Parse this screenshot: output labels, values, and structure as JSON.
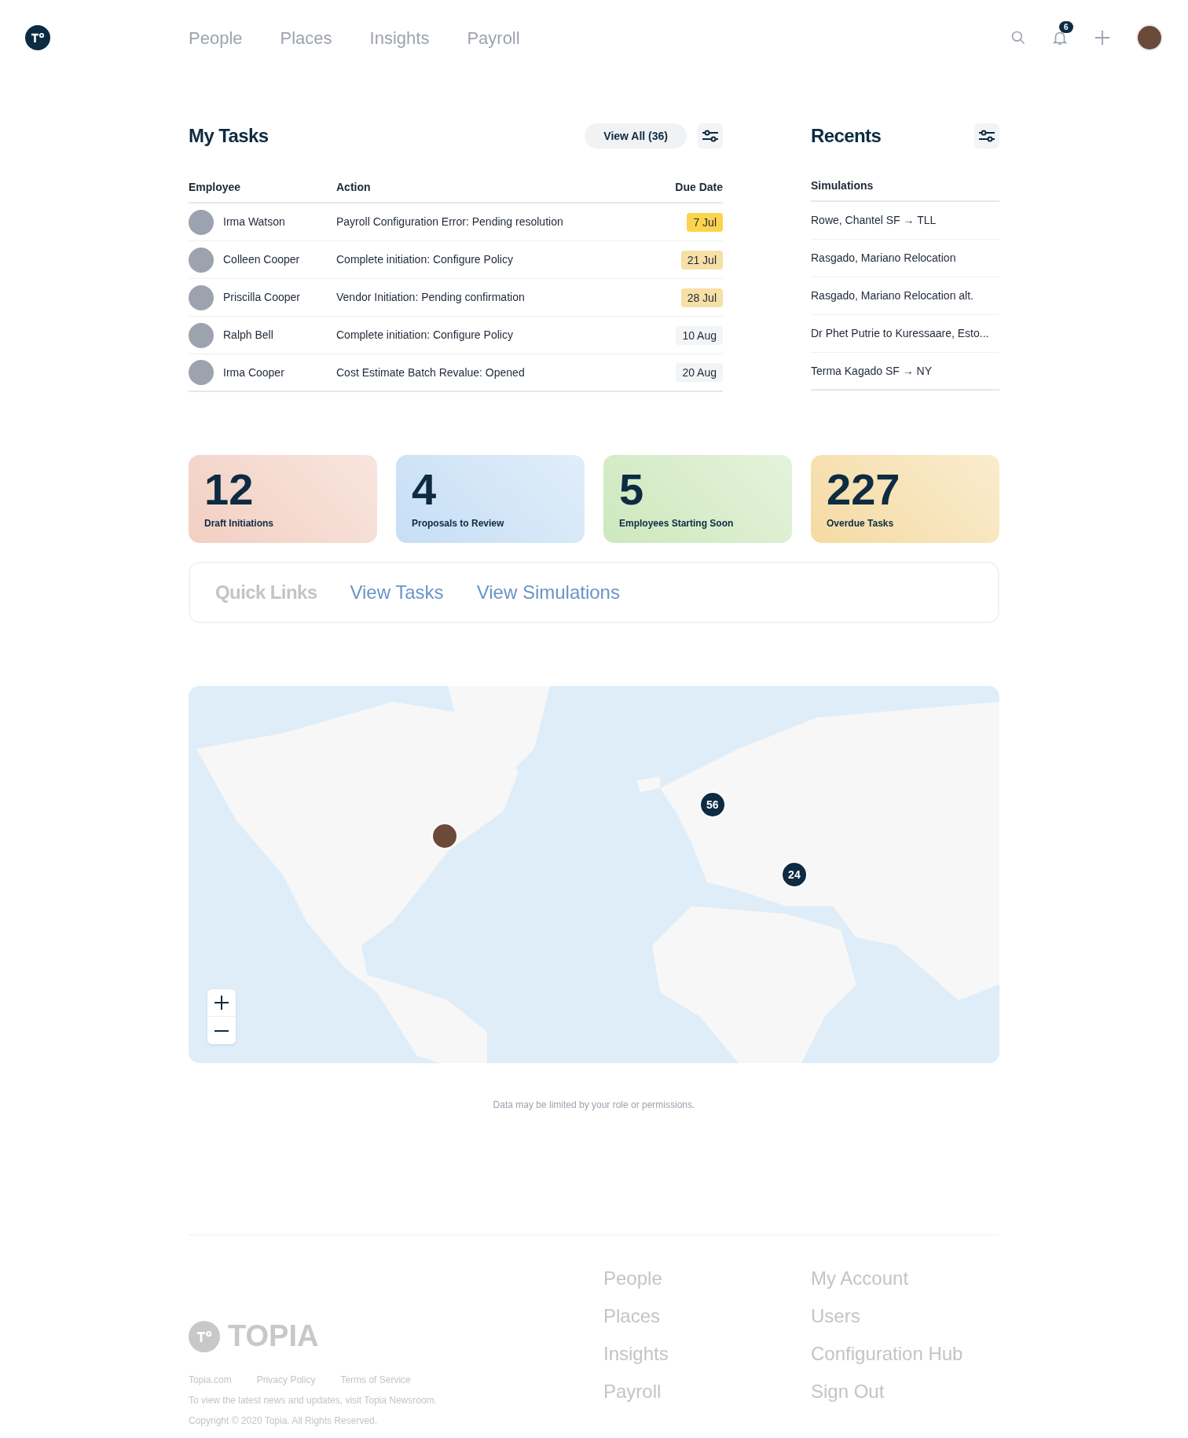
{
  "nav": {
    "items": [
      {
        "label": "People",
        "selected": false
      },
      {
        "label": "Places",
        "selected": false
      },
      {
        "label": "Insights",
        "selected": false
      },
      {
        "label": "Payroll",
        "selected": false
      }
    ],
    "notifications": "6"
  },
  "tasks": {
    "title": "My Tasks",
    "view_all": "View All (36)",
    "columns": [
      "Employee",
      "Action",
      "Due Date"
    ],
    "rows": [
      {
        "employee": "Irma Watson",
        "action": "Payroll Configuration Error: Pending resolution",
        "due": "7 Jul",
        "color": "#fcd34d"
      },
      {
        "employee": "Colleen Cooper",
        "action": "Complete initiation: Configure Policy",
        "due": "21 Jul",
        "color": "#f7e0a6"
      },
      {
        "employee": "Priscilla Cooper",
        "action": "Vendor Initiation: Pending confirmation",
        "due": "28 Jul",
        "color": "#f7e0a6"
      },
      {
        "employee": "Ralph Bell",
        "action": "Complete initiation: Configure Policy",
        "due": "10 Aug",
        "color": "#f3f4f6"
      },
      {
        "employee": "Irma Cooper",
        "action": "Cost Estimate Batch Revalue: Opened",
        "due": "20 Aug",
        "color": "#f3f4f6"
      }
    ]
  },
  "recents": {
    "title": "Recents",
    "column": "Simulations",
    "items": [
      "Rowe, Chantel SF → TLL",
      "Rasgado, Mariano Relocation",
      "Rasgado, Mariano Relocation alt.",
      "Dr Phet Putrie to Kuressaare, Esto...",
      "Terma Kagado SF → NY"
    ]
  },
  "stats": [
    {
      "value": "12",
      "label": "Draft Initiations",
      "color": "#f2cfc2"
    },
    {
      "value": "4",
      "label": "Proposals to Review",
      "color": "#c6def5"
    },
    {
      "value": "5",
      "label": "Employees Starting Soon",
      "color": "#cde8bd"
    },
    {
      "value": "227",
      "label": "Overdue Tasks",
      "color": "#f5dba3"
    }
  ],
  "quick_links": {
    "title": "Quick Links",
    "links": [
      "View Tasks",
      "View Simulations"
    ]
  },
  "map": {
    "clusters": [
      "56",
      "24"
    ]
  },
  "note": "Data may be limited by your role or permissions.",
  "footer": {
    "brand": "TOPIA",
    "links": [
      "Topia.com",
      "Privacy Policy",
      "Terms of Service"
    ],
    "news": "To view the latest news and updates, visit Topia Newsroom.",
    "copyright": "Copyright © 2020 Topia. All Rights Reserved.",
    "column_1": [
      "People",
      "Places",
      "Insights",
      "Payroll"
    ],
    "column_2": [
      "My Account",
      "Users",
      "Configuration Hub",
      "Sign Out"
    ]
  }
}
